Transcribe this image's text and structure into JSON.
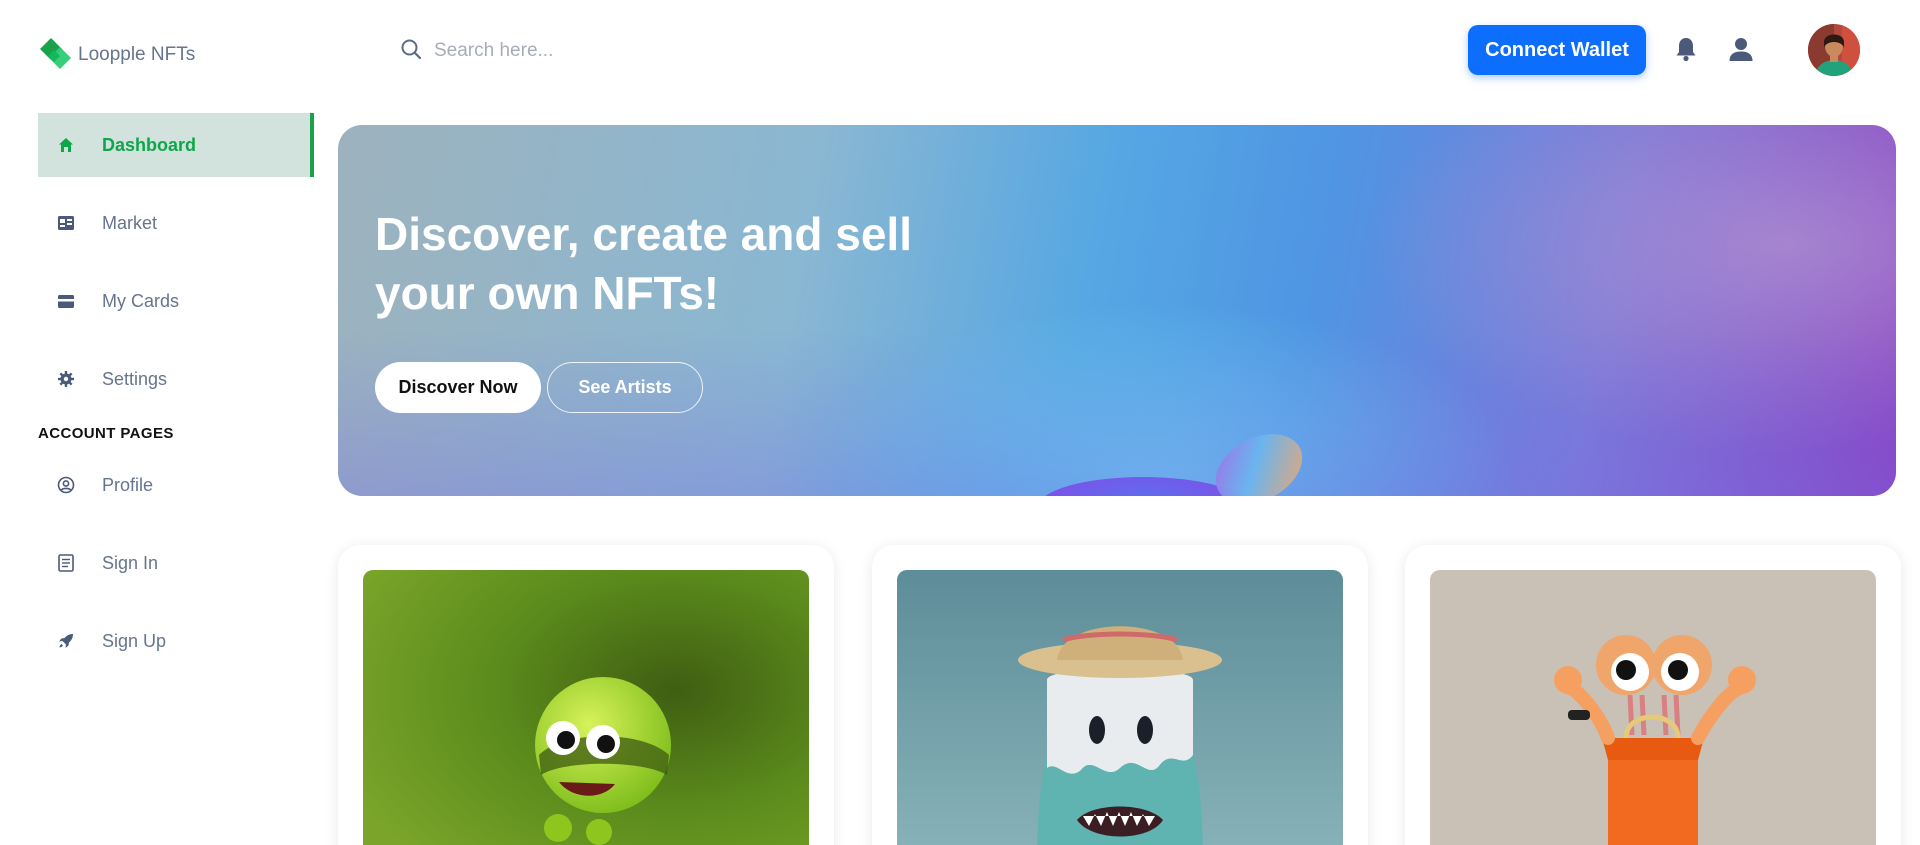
{
  "brand": {
    "name": "Loopple NFTs",
    "colors": {
      "green": "#18a34a",
      "greenLight": "#2ecc71"
    }
  },
  "sidebar": {
    "items": [
      {
        "label": "Dashboard",
        "icon": "home-icon",
        "active": true
      },
      {
        "label": "Market",
        "icon": "store-icon"
      },
      {
        "label": "My Cards",
        "icon": "card-icon"
      },
      {
        "label": "Settings",
        "icon": "gear-icon"
      }
    ],
    "section_title": "ACCOUNT PAGES",
    "account_items": [
      {
        "label": "Profile",
        "icon": "user-circle-icon"
      },
      {
        "label": "Sign In",
        "icon": "document-icon"
      },
      {
        "label": "Sign Up",
        "icon": "rocket-icon"
      }
    ]
  },
  "header": {
    "search": {
      "placeholder": "Search here..."
    },
    "connect_wallet": "Connect Wallet",
    "icons": [
      "bell-icon",
      "user-icon"
    ]
  },
  "hero": {
    "title": "Discover, create and sell your own NFTs!",
    "discover_button": "Discover Now",
    "artists_button": "See Artists"
  },
  "cards": [
    {
      "name": "green-character-card",
      "bg": "#5e8a1a"
    },
    {
      "name": "teal-monster-card",
      "bg": "#6e9ea6"
    },
    {
      "name": "orange-character-card",
      "bg": "#c8bfb4"
    }
  ]
}
